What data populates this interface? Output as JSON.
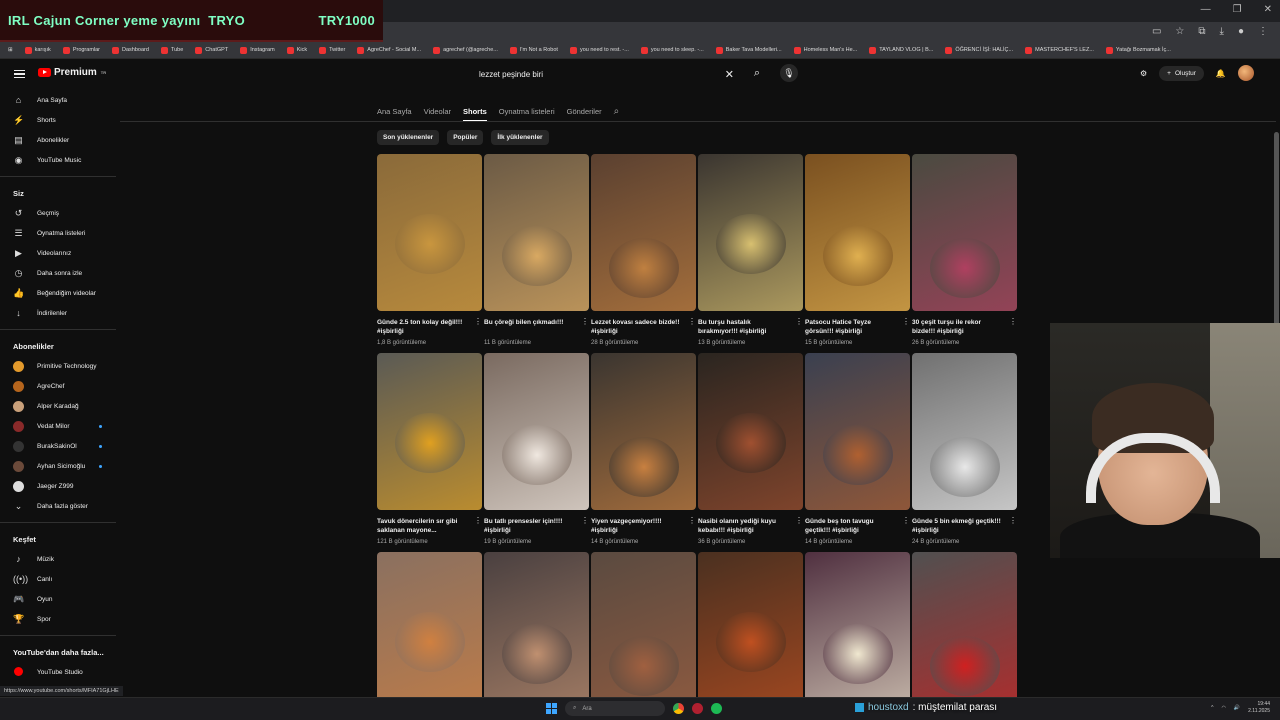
{
  "stream": {
    "title": "IRL Cajun Corner yeme yayını",
    "tag": "TRYO",
    "code": "TRY1000"
  },
  "bookmarks": [
    {
      "label": "karışık"
    },
    {
      "label": "Programlar"
    },
    {
      "label": "Dashboard"
    },
    {
      "label": "Tube"
    },
    {
      "label": "ChatGPT"
    },
    {
      "label": "Instagram"
    },
    {
      "label": "Kick"
    },
    {
      "label": "Twitter"
    },
    {
      "label": "AgreChef - Social M..."
    },
    {
      "label": "agrechef (@agreche..."
    },
    {
      "label": "I'm Not a Robot"
    },
    {
      "label": "you need to rest. -..."
    },
    {
      "label": "you need to sleep. -..."
    },
    {
      "label": "Baker Tava Modelleri..."
    },
    {
      "label": "Homeless Man's He..."
    },
    {
      "label": "TAYLAND VLOG | B..."
    },
    {
      "label": "ÖĞRENCİ İŞİ: HALİÇ..."
    },
    {
      "label": "MASTERCHEF'S LEZ..."
    },
    {
      "label": "Yatağı Bozmamak İç..."
    }
  ],
  "header": {
    "logo": "Premium",
    "logo_sup": "TR",
    "search_value": "lezzet peşinde biri",
    "create_label": "Oluştur"
  },
  "sidebar": {
    "main": [
      {
        "label": "Ana Sayfa",
        "icon": "home-icon",
        "glyph": "⌂"
      },
      {
        "label": "Shorts",
        "icon": "shorts-icon",
        "glyph": "⚡"
      },
      {
        "label": "Abonelikler",
        "icon": "subscriptions-icon",
        "glyph": "▤"
      },
      {
        "label": "YouTube Music",
        "icon": "music-icon",
        "glyph": "◉"
      }
    ],
    "you_title": "Siz",
    "you": [
      {
        "label": "Geçmiş",
        "glyph": "↺"
      },
      {
        "label": "Oynatma listeleri",
        "glyph": "☰"
      },
      {
        "label": "Videolarınız",
        "glyph": "▶"
      },
      {
        "label": "Daha sonra izle",
        "glyph": "◷"
      },
      {
        "label": "Beğendiğim videolar",
        "glyph": "👍"
      },
      {
        "label": "İndirilenler",
        "glyph": "↓"
      }
    ],
    "subs_title": "Abonelikler",
    "subs": [
      {
        "label": "Primitive Technology",
        "color": "#e39a2c",
        "dot": false
      },
      {
        "label": "AgreChef",
        "color": "#b5651d",
        "dot": false
      },
      {
        "label": "Alper Karadağ",
        "color": "#c9a07a",
        "dot": false
      },
      {
        "label": "Vedat Milor",
        "color": "#8a2a2a",
        "dot": true
      },
      {
        "label": "BurakSakinOl",
        "color": "#333333",
        "dot": true
      },
      {
        "label": "Ayhan Sicimoğlu",
        "color": "#6b4a3a",
        "dot": true
      },
      {
        "label": "Jaeger Z999",
        "color": "#dddddd",
        "dot": false
      }
    ],
    "more_label": "Daha fazla göster",
    "explore_title": "Keşfet",
    "explore": [
      {
        "label": "Müzik",
        "glyph": "♪"
      },
      {
        "label": "Canlı",
        "glyph": "((•))"
      },
      {
        "label": "Oyun",
        "glyph": "🎮"
      },
      {
        "label": "Spor",
        "glyph": "🏆"
      }
    ],
    "more_yt_title": "YouTube'dan daha fazla...",
    "more_yt": [
      {
        "label": "YouTube Studio"
      },
      {
        "label": "YouTube Music"
      }
    ]
  },
  "tabs": [
    {
      "label": "Ana Sayfa",
      "active": false
    },
    {
      "label": "Videolar",
      "active": false
    },
    {
      "label": "Shorts",
      "active": true
    },
    {
      "label": "Oynatma listeleri",
      "active": false
    },
    {
      "label": "Gönderiler",
      "active": false
    }
  ],
  "chips": [
    {
      "label": "Son yüklenenler"
    },
    {
      "label": "Popüler"
    },
    {
      "label": "İlk yüklenenler"
    }
  ],
  "shorts": [
    {
      "title": "Günde 2.5 ton kolay değil!!!         #işbirliği",
      "views": "1,8 B görüntüleme",
      "bg": "#8a6a3a",
      "accent": "#c9963e"
    },
    {
      "title": "Bu çöreği bilen çıkmadı!!!",
      "views": "11 B görüntüleme",
      "bg": "#6b5a45",
      "accent": "#d9a962"
    },
    {
      "title": "Lezzet kovası sadece bizde!!           #işbirliği",
      "views": "28 B görüntüleme",
      "bg": "#5a4030",
      "accent": "#c08040"
    },
    {
      "title": "Bu turşu hastalık bırakmıyor!!!     #işbirliği",
      "views": "13 B görüntüleme",
      "bg": "#3a3530",
      "accent": "#d8c070"
    },
    {
      "title": "Patsocu Hatice Teyze görsün!!!       #işbirliği",
      "views": "15 B görüntüleme",
      "bg": "#7a5020",
      "accent": "#e0b050"
    },
    {
      "title": "30 çeşit turşu ile rekor bizde!!!         #işbirliği",
      "views": "26 B görüntüleme",
      "bg": "#4a4a40",
      "accent": "#b04060"
    },
    {
      "title": "Tavuk dönercilerin sır gibi saklanan mayone...",
      "views": "121 B görüntüleme",
      "bg": "#5a5a55",
      "accent": "#e0a020"
    },
    {
      "title": "Bu tatlı prensesler için!!!!  #işbirliği",
      "views": "19 B görüntüleme",
      "bg": "#7a6a60",
      "accent": "#f0e8e0"
    },
    {
      "title": "Yiyen vazgeçemiyor!!!!  #işbirliği",
      "views": "14 B görüntüleme",
      "bg": "#3a3530",
      "accent": "#c88040"
    },
    {
      "title": "Nasibi olanın yediği kuyu kebabı!!!     #işbirliği",
      "views": "36 B görüntüleme",
      "bg": "#2a2520",
      "accent": "#a05030"
    },
    {
      "title": "Günde beş ton tavugu geçtik!!!       #işbirliği",
      "views": "14 B görüntüleme",
      "bg": "#3a4050",
      "accent": "#b06030"
    },
    {
      "title": "Günde 5 bin ekmeği geçtik!!!          #işbirliği",
      "views": "24 B görüntüleme",
      "bg": "#707070",
      "accent": "#e8e8e8"
    },
    {
      "title": "",
      "views": "",
      "bg": "#8a7060",
      "accent": "#d08040"
    },
    {
      "title": "",
      "views": "",
      "bg": "#4a4040",
      "accent": "#c09070"
    },
    {
      "title": "",
      "views": "",
      "bg": "#5a4a40",
      "accent": "#a06040"
    },
    {
      "title": "",
      "views": "",
      "bg": "#4a3020",
      "accent": "#c05020"
    },
    {
      "title": "",
      "views": "",
      "bg": "#503040",
      "accent": "#f0e8d0"
    },
    {
      "title": "",
      "views": "",
      "bg": "#505050",
      "accent": "#d02020"
    }
  ],
  "status_url": "https://www.youtube.com/shorts/MFIA71GjLHE",
  "taskbar": {
    "search_placeholder": "Ara",
    "time": "19:44",
    "date": "2.11.2025"
  },
  "overlay": {
    "user": "houstoxd",
    "message": ": müştemilat parası"
  }
}
